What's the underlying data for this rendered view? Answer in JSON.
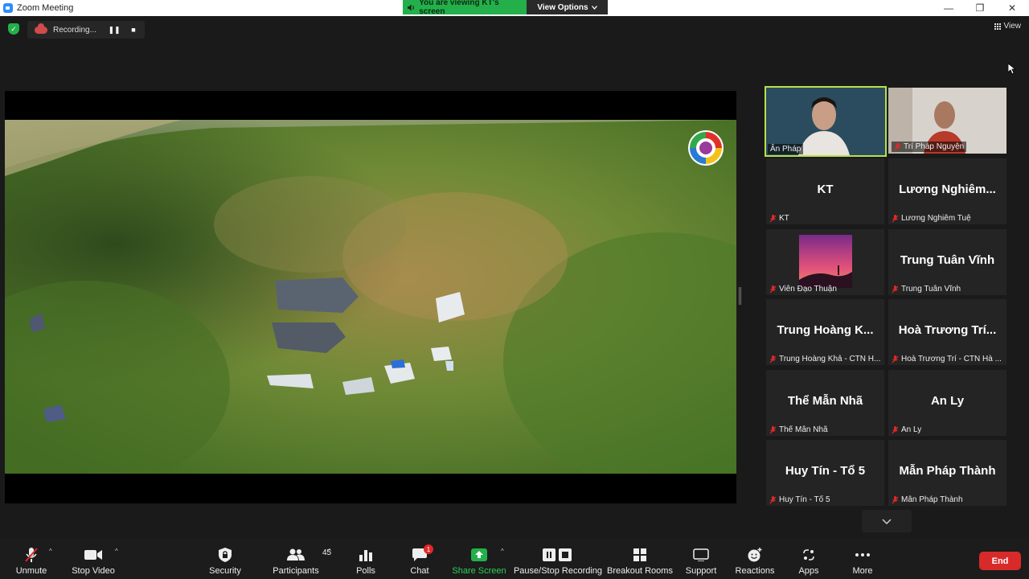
{
  "window": {
    "title": "Zoom Meeting",
    "minimize": "—",
    "maximize": "❐",
    "close": "✕"
  },
  "share_banner": {
    "viewing_text": "You are viewing KT's screen",
    "view_options": "View Options"
  },
  "recording": {
    "label": "Recording...",
    "pause": "❚❚",
    "stop": "■"
  },
  "view_button": "View",
  "participants": [
    {
      "name": "Ân Pháp",
      "type": "video",
      "active": true
    },
    {
      "name": "Trí Pháp Nguyện",
      "type": "video",
      "active": false
    },
    {
      "display": "KT",
      "name": "KT",
      "type": "name"
    },
    {
      "display": "Lương Nghiêm...",
      "name": "Lương Nghiêm Tuệ",
      "type": "name"
    },
    {
      "name": "Viên Đạo Thuận",
      "type": "image"
    },
    {
      "display": "Trung Tuân Vĩnh",
      "name": "Trung Tuân Vĩnh",
      "type": "name"
    },
    {
      "display": "Trung Hoàng K...",
      "name": "Trung Hoàng Khả - CTN H...",
      "type": "name"
    },
    {
      "display": "Hoà Trương Trí...",
      "name": "Hoà Trương Trí - CTN Hà ...",
      "type": "name"
    },
    {
      "display": "Thể Mẫn Nhã",
      "name": "Thể Mẫn Nhã",
      "type": "name"
    },
    {
      "display": "An Ly",
      "name": "An Ly",
      "type": "name"
    },
    {
      "display": "Huy Tín - Tổ 5",
      "name": "Huy Tín - Tổ 5",
      "type": "name"
    },
    {
      "display": "Mẫn Pháp Thành",
      "name": "Mẫn Pháp Thành",
      "type": "name"
    }
  ],
  "toolbar": {
    "unmute": "Unmute",
    "stop_video": "Stop Video",
    "security": "Security",
    "participants": "Participants",
    "participants_count": "45",
    "polls": "Polls",
    "chat": "Chat",
    "chat_badge": "1",
    "share_screen": "Share Screen",
    "pause_stop_recording": "Pause/Stop Recording",
    "breakout_rooms": "Breakout Rooms",
    "support": "Support",
    "reactions": "Reactions",
    "apps": "Apps",
    "more": "More",
    "end": "End"
  },
  "colors": {
    "accent_green": "#23b04b",
    "active_speaker": "#b7e04b",
    "end_red": "#d92a2a",
    "muted_red": "#e02828"
  }
}
